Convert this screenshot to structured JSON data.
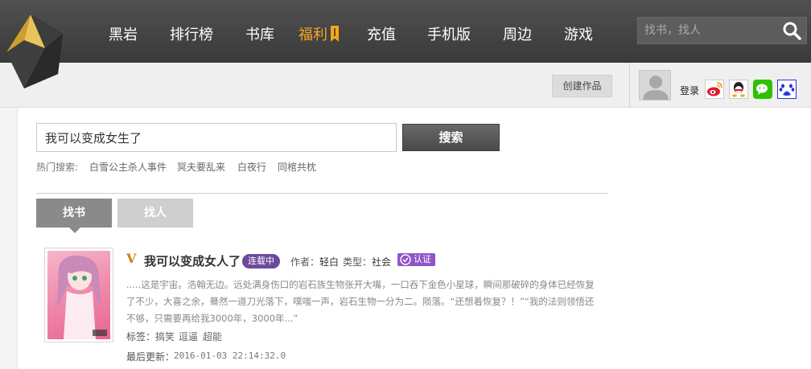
{
  "nav": {
    "items": [
      {
        "label": "黑岩"
      },
      {
        "label": "排行榜"
      },
      {
        "label": "书库"
      },
      {
        "label": "福利"
      },
      {
        "label": "充值"
      },
      {
        "label": "手机版"
      },
      {
        "label": "周边"
      },
      {
        "label": "游戏"
      }
    ],
    "active_index": 3,
    "search_placeholder": "找书，找人"
  },
  "subbar": {
    "create_label": "创建作品",
    "login_label": "登录",
    "social_icons": [
      "weibo-icon",
      "qq-icon",
      "wechat-icon",
      "baidu-icon"
    ]
  },
  "search": {
    "query": "我可以变成女生了",
    "button_label": "搜索",
    "hot_label": "热门搜索:",
    "hot_terms": [
      "白雪公主杀人事件",
      "冥夫要乱来",
      "白夜行",
      "同棺共枕"
    ]
  },
  "tabs": [
    {
      "label": "找书",
      "active": true
    },
    {
      "label": "找人",
      "active": false
    }
  ],
  "result": {
    "v_mark": "V",
    "title": "我可以变成女人了",
    "status": "连载中",
    "author_label": "作者：",
    "author": "轻白",
    "type_label": "类型：",
    "type": "社会",
    "cert_label": "认证",
    "description": ".....这是宇宙。浩翰无边。远处满身伤口的岩石族生物张开大嘴，一口吞下金色小星球，瞬间那破碎的身体已经恢复了不少，大喜之余，蓦然一道刀光落下，噗嗤一声，岩石生物一分为二。陨落。“还想着恢复？！”“我的法则领悟还不够，只需要再给我3000年，3000年...”",
    "tags_label": "标签：",
    "tags": [
      "搞笑",
      "逗逼",
      "超能"
    ],
    "updated_label": "最后更新：",
    "updated": "2016-01-03 22:14:32.0"
  },
  "colors": {
    "nav_bg": "#3a3a3a",
    "nav_active": "#f5a623",
    "status_badge": "#6b4a9b",
    "cert_badge": "#8f56c9"
  }
}
